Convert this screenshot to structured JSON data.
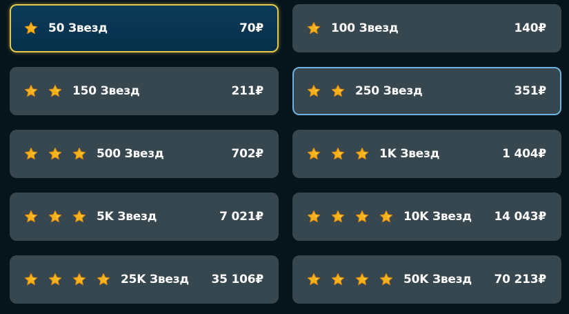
{
  "colors": {
    "background": "#06141c",
    "card": "#37474f",
    "selected_card": "#0b3a58",
    "selected_border": "#e8c84a",
    "highlight_border": "#6fb3dc",
    "star": "#f6b21b"
  },
  "packages": [
    {
      "label": "50 Звезд",
      "price": "70₽",
      "stars": 1,
      "state": "selected",
      "icon": "star-icon"
    },
    {
      "label": "100 Звезд",
      "price": "140₽",
      "stars": 1,
      "state": "normal",
      "icon": "star-icon"
    },
    {
      "label": "150 Звезд",
      "price": "211₽",
      "stars": 2,
      "state": "normal",
      "icon": "star-icon"
    },
    {
      "label": "250 Звезд",
      "price": "351₽",
      "stars": 2,
      "state": "highlighted",
      "icon": "star-icon"
    },
    {
      "label": "500 Звезд",
      "price": "702₽",
      "stars": 3,
      "state": "normal",
      "icon": "star-icon"
    },
    {
      "label": "1K Звезд",
      "price": "1 404₽",
      "stars": 3,
      "state": "normal",
      "icon": "star-icon"
    },
    {
      "label": "5K Звезд",
      "price": "7 021₽",
      "stars": 3,
      "state": "normal",
      "icon": "star-icon"
    },
    {
      "label": "10K Звезд",
      "price": "14 043₽",
      "stars": 4,
      "state": "normal",
      "icon": "star-icon"
    },
    {
      "label": "25K Звезд",
      "price": "35 106₽",
      "stars": 4,
      "state": "normal",
      "icon": "star-icon"
    },
    {
      "label": "50K Звезд",
      "price": "70 213₽",
      "stars": 4,
      "state": "normal",
      "icon": "star-icon"
    }
  ]
}
